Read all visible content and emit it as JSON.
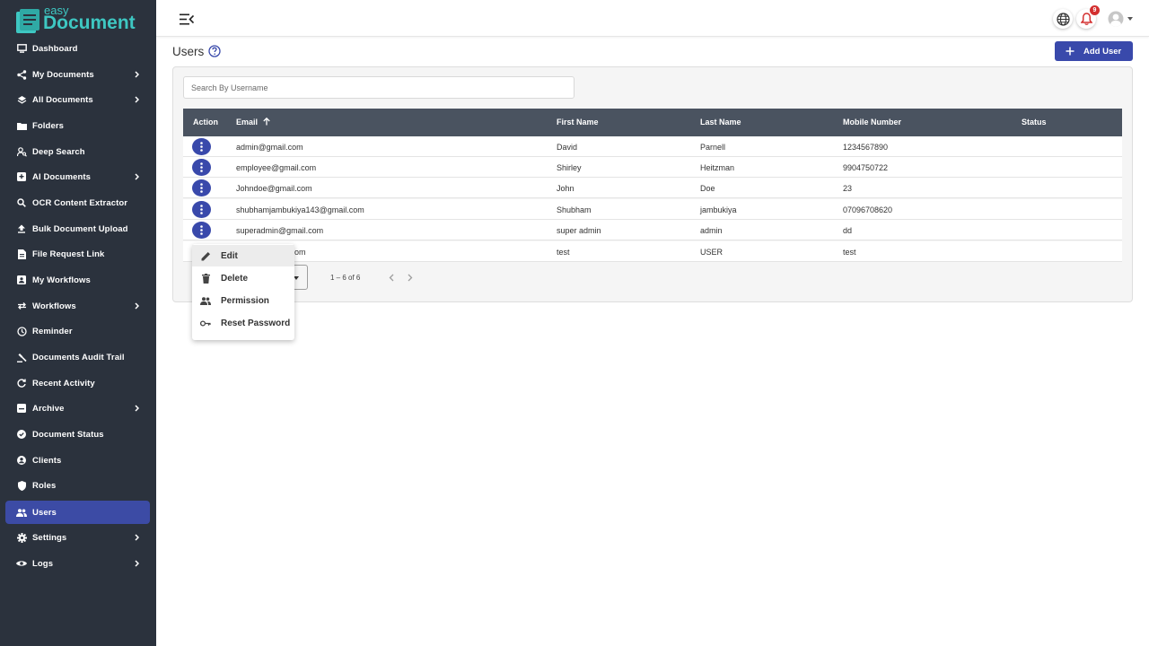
{
  "app": {
    "logo_small": "easy",
    "logo_big": "Document",
    "brand_color": "#3ec7c2",
    "accent": "#3949ab",
    "sidebar_bg": "#2b323d"
  },
  "sidebar": {
    "items": [
      {
        "label": "Dashboard",
        "icon": "monitor-icon",
        "chevron": false
      },
      {
        "label": "My Documents",
        "icon": "share-icon",
        "chevron": true
      },
      {
        "label": "All Documents",
        "icon": "layers-icon",
        "chevron": true
      },
      {
        "label": "Folders",
        "icon": "folder-icon",
        "chevron": false
      },
      {
        "label": "Deep Search",
        "icon": "person-search-icon",
        "chevron": false
      },
      {
        "label": "AI Documents",
        "icon": "ai-document-icon",
        "chevron": true
      },
      {
        "label": "OCR Content Extractor",
        "icon": "search-icon",
        "chevron": false
      },
      {
        "label": "Bulk Document Upload",
        "icon": "upload-icon",
        "chevron": false
      },
      {
        "label": "File Request Link",
        "icon": "file-icon",
        "chevron": false
      },
      {
        "label": "My Workflows",
        "icon": "workflow-icon",
        "chevron": false
      },
      {
        "label": "Workflows",
        "icon": "repeat-icon",
        "chevron": true
      },
      {
        "label": "Reminder",
        "icon": "clock-icon",
        "chevron": false
      },
      {
        "label": "Documents Audit Trail",
        "icon": "gavel-icon",
        "chevron": false
      },
      {
        "label": "Recent Activity",
        "icon": "refresh-icon",
        "chevron": false
      },
      {
        "label": "Archive",
        "icon": "archive-icon",
        "chevron": true
      },
      {
        "label": "Document Status",
        "icon": "check-badge-icon",
        "chevron": false
      },
      {
        "label": "Clients",
        "icon": "account-circle-icon",
        "chevron": false
      },
      {
        "label": "Roles",
        "icon": "shield-icon",
        "chevron": false
      },
      {
        "label": "Users",
        "icon": "people-icon",
        "chevron": false,
        "active": true
      },
      {
        "label": "Settings",
        "icon": "gear-icon",
        "chevron": true
      },
      {
        "label": "Logs",
        "icon": "eye-icon",
        "chevron": true
      }
    ]
  },
  "header": {
    "notification_count": "9"
  },
  "page": {
    "title": "Users",
    "add_button": "Add User",
    "search_placeholder": "Search By Username"
  },
  "table": {
    "columns": [
      "Action",
      "Email",
      "First Name",
      "Last Name",
      "Mobile Number",
      "Status"
    ],
    "rows": [
      {
        "email": "admin@gmail.com",
        "first": "David",
        "last": "Parnell",
        "mobile": "1234567890"
      },
      {
        "email": "employee@gmail.com",
        "first": "Shirley",
        "last": "Heitzman",
        "mobile": "9904750722"
      },
      {
        "email": "Johndoe@gmail.com",
        "first": "John",
        "last": "Doe",
        "mobile": "23"
      },
      {
        "email": "shubhamjambukiya143@gmail.com",
        "first": "Shubham",
        "last": "jambukiya",
        "mobile": "07096708620"
      },
      {
        "email": "superadmin@gmail.com",
        "first": "super admin",
        "last": "admin",
        "mobile": "dd"
      },
      {
        "email": "om",
        "first": "test",
        "last": "USER",
        "mobile": "test"
      }
    ]
  },
  "pagination": {
    "range": "1 – 6 of 6"
  },
  "context_menu": {
    "items": [
      {
        "label": "Edit",
        "icon": "pencil-icon"
      },
      {
        "label": "Delete",
        "icon": "trash-icon"
      },
      {
        "label": "Permission",
        "icon": "people-icon"
      },
      {
        "label": "Reset Password",
        "icon": "key-icon"
      }
    ]
  }
}
